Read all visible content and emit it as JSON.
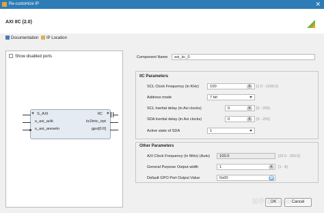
{
  "window": {
    "title": "Re-customize IP",
    "close_glyph": "✕"
  },
  "header": {
    "ip_name": "AXI IIC (2.0)"
  },
  "links": {
    "documentation": "Documentation",
    "ip_location": "IP Location"
  },
  "symbol_panel": {
    "show_disabled_ports": "Show disabled ports",
    "left_ports": [
      "S_AXI",
      "s_axi_aclk",
      "s_axi_aresetn"
    ],
    "right_ports": [
      "IIC",
      "iic2intc_irpt",
      "gpo[0:0]"
    ]
  },
  "component_name": {
    "label": "Component Name",
    "value": "axi_iic_0"
  },
  "iic_parameters": {
    "title": "IIC Parameters",
    "scl_clock": {
      "label": "SCL Clock Frequency (in KHz)",
      "value": "100",
      "range": "[1.0 - 1000.0]"
    },
    "address_mode": {
      "label": "Address mode",
      "value": "7 bit"
    },
    "scl_inertial": {
      "label": "SCL Inertial delay (in Axi clocks)",
      "value": "0",
      "range": "[0 - 255]"
    },
    "sda_inertial": {
      "label": "SDA Inertial delay (in Axi clocks)",
      "value": "0",
      "range": "[0 - 255]"
    },
    "active_state_sda": {
      "label": "Active state of SDA",
      "value": "1"
    }
  },
  "other_parameters": {
    "title": "Other Parameters",
    "axi_clock": {
      "label": "AXI Clock Frequency (in MHz) (Auto)",
      "value": "100.0",
      "range": "[25.0 - 300.0]"
    },
    "gpo_width": {
      "label": "General Purpose Output width",
      "value": "1",
      "range": "[1 - 8]"
    },
    "gpo_default": {
      "label": "Default GPO Port Output Value",
      "value": "0x00"
    }
  },
  "buttons": {
    "ok": "OK",
    "cancel": "Cancel"
  },
  "watermark": "知乎 @ Tiamo",
  "colors": {
    "titlebar": "#2d7cb6",
    "ip_block": "#e4ebf3",
    "logo_green": "#7cb342",
    "logo_orange": "#f39c12"
  }
}
